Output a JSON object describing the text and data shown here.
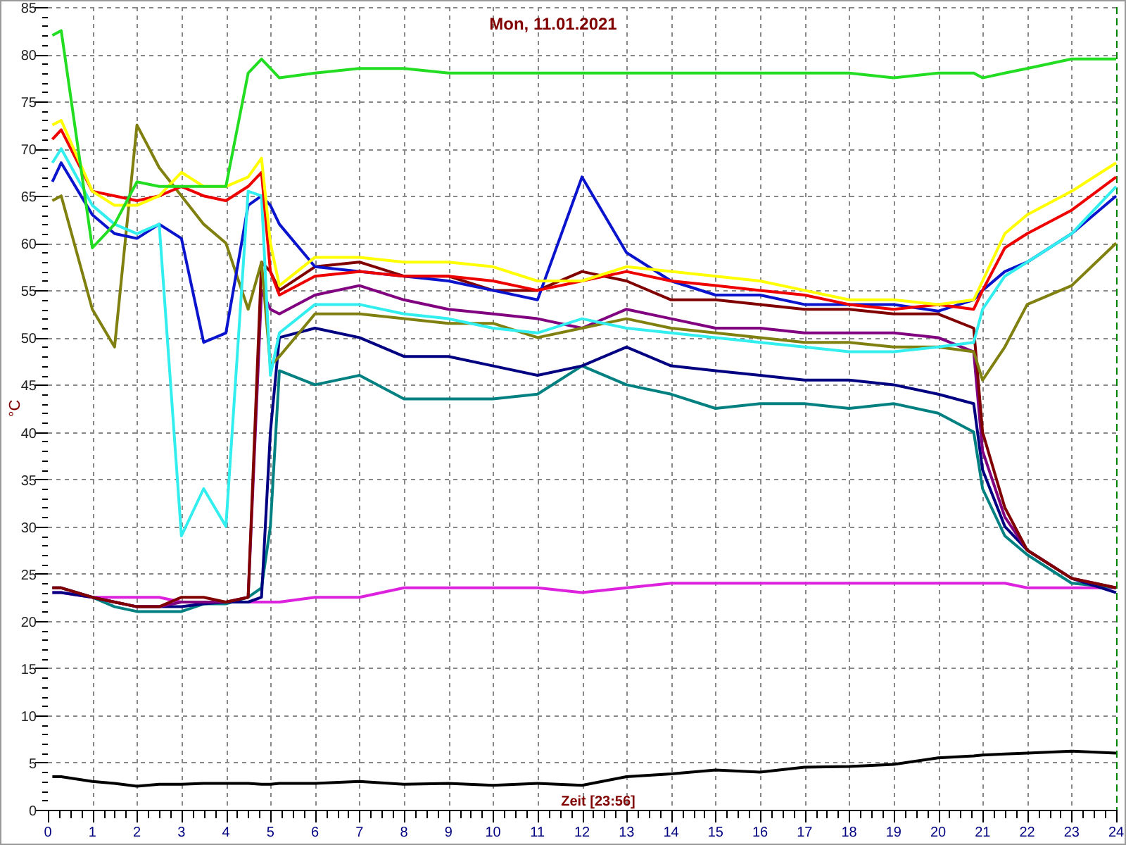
{
  "chart": {
    "chart_data": {
      "type": "line",
      "grid": true,
      "title": "Mon, 11.01.2021",
      "xlabel": "Zeit [23:56]",
      "ylabel": "°C",
      "xlim": [
        0,
        24
      ],
      "ylim": [
        0,
        85
      ],
      "xticks": [
        0,
        1,
        2,
        3,
        4,
        5,
        6,
        7,
        8,
        9,
        10,
        11,
        12,
        13,
        14,
        15,
        16,
        17,
        18,
        19,
        20,
        21,
        22,
        23,
        24
      ],
      "yticks": [
        0,
        5,
        10,
        15,
        20,
        25,
        30,
        35,
        40,
        45,
        50,
        55,
        60,
        65,
        70,
        75,
        80,
        85
      ],
      "x": [
        0.1,
        0.3,
        1,
        1.5,
        2,
        2.5,
        3,
        3.5,
        4,
        4.5,
        4.8,
        5,
        5.2,
        6,
        7,
        8,
        9,
        10,
        11,
        12,
        13,
        14,
        15,
        16,
        17,
        18,
        19,
        20,
        20.8,
        21,
        21.5,
        22,
        23,
        24
      ],
      "series": [
        {
          "color": "#000000",
          "values": [
            3.5,
            3.5,
            3,
            2.8,
            2.5,
            2.7,
            2.7,
            2.8,
            2.8,
            2.8,
            2.7,
            2.7,
            2.8,
            2.8,
            3,
            2.7,
            2.8,
            2.6,
            2.8,
            2.6,
            3.5,
            3.8,
            4.2,
            4,
            4.5,
            4.6,
            4.8,
            5.5,
            5.7,
            5.8,
            5.9,
            6,
            6.2,
            6
          ]
        },
        {
          "color": "#dd22dd",
          "values": [
            23,
            23,
            22.5,
            22.5,
            22.5,
            22.5,
            22,
            22,
            22,
            22,
            22,
            22,
            22,
            22.5,
            22.5,
            23.5,
            23.5,
            23.5,
            23.5,
            23,
            23.5,
            24,
            24,
            24,
            24,
            24,
            24,
            24,
            24,
            24,
            24,
            23.5,
            23.5,
            23.5
          ]
        },
        {
          "color": "#008080",
          "values": [
            23.5,
            23.5,
            22.5,
            21.5,
            21,
            21,
            21,
            21.8,
            21.8,
            22.5,
            23.5,
            30,
            46.5,
            45,
            46,
            43.5,
            43.5,
            43.5,
            44,
            47,
            45,
            44,
            42.5,
            43,
            43,
            42.5,
            43,
            42,
            40,
            34,
            29,
            27,
            24,
            23.5
          ]
        },
        {
          "color": "#000080",
          "values": [
            23,
            23,
            22.5,
            22,
            21.5,
            21.5,
            21.5,
            21.8,
            22,
            22,
            22.5,
            40,
            50,
            51,
            50,
            48,
            48,
            47,
            46,
            47,
            49,
            47,
            46.5,
            46,
            45.5,
            45.5,
            45,
            44,
            43,
            36,
            30,
            27.5,
            24.5,
            23
          ]
        },
        {
          "color": "#800080",
          "values": [
            23.5,
            23.5,
            22.5,
            22,
            21.5,
            21.5,
            22,
            22,
            22,
            22.5,
            55,
            53,
            52.5,
            54.5,
            55.5,
            54,
            53,
            52.5,
            52,
            51,
            53,
            52,
            51,
            51,
            50.5,
            50.5,
            50.5,
            50,
            48.5,
            38,
            31,
            27.5,
            24.5,
            23.5
          ]
        },
        {
          "color": "#800000",
          "values": [
            23.5,
            23.5,
            22.5,
            22,
            21.5,
            21.5,
            22.5,
            22.5,
            22,
            22.5,
            58,
            57,
            55,
            57.5,
            58,
            56.5,
            56.5,
            55,
            55,
            57,
            56,
            54,
            54,
            53.5,
            53,
            53,
            52.5,
            52.5,
            51,
            40,
            32,
            27.5,
            24.5,
            23.5
          ]
        },
        {
          "color": "#808010",
          "values": [
            64.5,
            65,
            53,
            49,
            72.5,
            68,
            65,
            62,
            60,
            53,
            58,
            47,
            48,
            52.5,
            52.5,
            52,
            51.5,
            51.5,
            50,
            51,
            52,
            51,
            50.5,
            50,
            49.5,
            49.5,
            49,
            49,
            48.5,
            45.5,
            49,
            53.5,
            55.5,
            60
          ]
        },
        {
          "color": "#0a14cc",
          "values": [
            66.5,
            68.5,
            63,
            61,
            60.5,
            62,
            60.5,
            49.5,
            50.5,
            64,
            65,
            64,
            62,
            57.5,
            57,
            56.5,
            56,
            55,
            54,
            67,
            59,
            56,
            54.5,
            54.5,
            53.5,
            53.5,
            53.5,
            52.8,
            54,
            55,
            57,
            58,
            61,
            65
          ]
        },
        {
          "color": "#33eeee",
          "values": [
            68.5,
            70,
            64,
            62,
            61,
            62,
            29,
            34,
            30,
            65.5,
            65,
            46,
            50.5,
            53.5,
            53.5,
            52.5,
            52,
            51,
            50.5,
            52,
            51,
            50.5,
            50,
            49.5,
            49,
            48.5,
            48.5,
            49,
            49.5,
            53,
            56.5,
            58,
            61,
            66
          ]
        },
        {
          "color": "#ee0000",
          "values": [
            71,
            72,
            65.5,
            65,
            64.5,
            65,
            66,
            65,
            64.5,
            66,
            67.5,
            57,
            54.5,
            56.5,
            57,
            56.5,
            56.5,
            56,
            55,
            56,
            57,
            56,
            55.5,
            55,
            54.5,
            53.5,
            53,
            53.5,
            53,
            55,
            59.5,
            61,
            63.5,
            67
          ]
        },
        {
          "color": "#ffff00",
          "values": [
            72.5,
            73,
            65.5,
            64,
            64,
            65,
            67.5,
            66,
            66,
            67,
            69,
            60,
            55.5,
            58.5,
            58.5,
            58,
            58,
            57.5,
            56,
            56,
            57.5,
            57,
            56.5,
            56,
            55,
            54,
            54,
            53.5,
            54,
            56,
            61,
            63,
            65.5,
            68.5
          ]
        },
        {
          "color": "#22dd22",
          "values": [
            82,
            82.5,
            59.5,
            62,
            66.5,
            66,
            66,
            66,
            66,
            78,
            79.5,
            78.5,
            77.5,
            78,
            78.5,
            78.5,
            78,
            78,
            78,
            78,
            78,
            78,
            78,
            78,
            78,
            78,
            77.5,
            78,
            78,
            77.5,
            78,
            78.5,
            79.5,
            79.5
          ]
        }
      ]
    }
  }
}
